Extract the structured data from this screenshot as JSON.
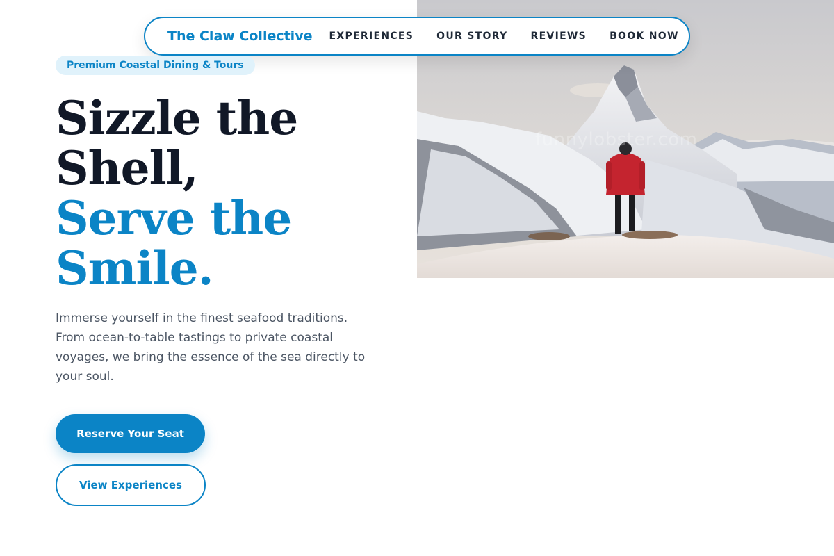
{
  "brand": {
    "name": "The Claw Collective",
    "color": "#0b84c6"
  },
  "nav": {
    "items": [
      {
        "label": "EXPERIENCES"
      },
      {
        "label": "OUR STORY"
      },
      {
        "label": "REVIEWS"
      },
      {
        "label": "BOOK NOW"
      }
    ]
  },
  "hero": {
    "badge": "Premium Coastal Dining & Tours",
    "headline_line1": "Sizzle the",
    "headline_line2": "Shell,",
    "headline_line3": "Serve the",
    "headline_line4": "Smile.",
    "description": "Immerse yourself in the finest seafood traditions. From ocean-to-table tastings to private coastal voyages, we bring the essence of the sea directly to your soul.",
    "primary_cta": "Reserve Your Seat",
    "secondary_cta": "View Experiences",
    "image_watermark": "funnylobster.com"
  },
  "colors": {
    "accent": "#0b84c6",
    "headline_dark": "#111827",
    "body_text": "#4b5563",
    "badge_bg": "#e0f2fb"
  }
}
